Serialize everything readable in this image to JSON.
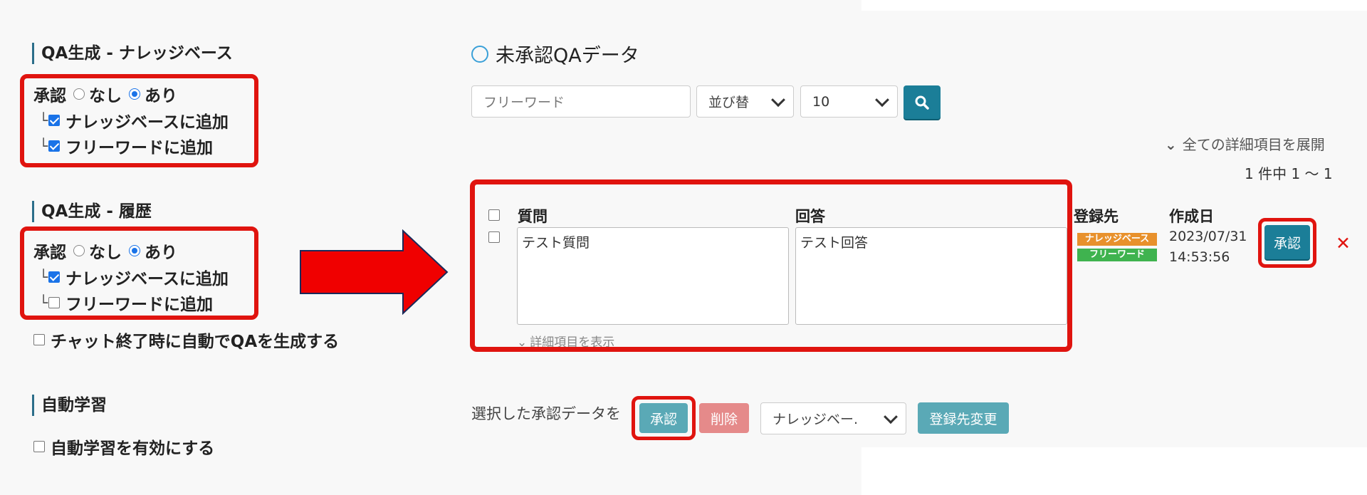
{
  "left": {
    "section_kb": {
      "title": "QA生成 - ナレッジベース",
      "approval_label": "承認",
      "opt_none": "なし",
      "opt_yes": "あり",
      "add_kb": "ナレッジベースに追加",
      "add_freeword": "フリーワードに追加"
    },
    "section_history": {
      "title": "QA生成 - 履歴",
      "approval_label": "承認",
      "opt_none": "なし",
      "opt_yes": "あり",
      "add_kb": "ナレッジベースに追加",
      "add_freeword": "フリーワードに追加"
    },
    "chat_end_auto": "チャット終了時に自動でQAを生成する",
    "section_auto": {
      "title": "自動学習",
      "enable_label": "自動学習を有効にする"
    },
    "tree_glyph": "└"
  },
  "right": {
    "title": "未承認QAデータ",
    "search": {
      "placeholder": "フリーワード",
      "sort_label": "並び替",
      "per_page": "10",
      "search_icon": "search-icon"
    },
    "expand_all": "全ての詳細項目を展開",
    "count": "1 件中 1 〜 1",
    "table": {
      "col_question": "質問",
      "col_answer": "回答",
      "col_register": "登録先",
      "col_created": "作成日",
      "row": {
        "question": "テスト質問",
        "answer": "テスト回答",
        "badges": [
          "ナレッジベース",
          "フリーワード"
        ],
        "date": "2023/07/31",
        "time": "14:53:56",
        "approve_label": "承認",
        "delete_icon": "✕"
      },
      "show_details": "詳細項目を表示"
    },
    "bulk": {
      "label": "選択した承認データを",
      "approve": "承認",
      "delete": "削除",
      "target": "ナレッジベー.",
      "change": "登録先変更"
    }
  },
  "colors": {
    "accent": "#1a7f9c",
    "red": "#e0140f",
    "badge_orange": "#e8912c",
    "badge_green": "#3fb34f"
  }
}
